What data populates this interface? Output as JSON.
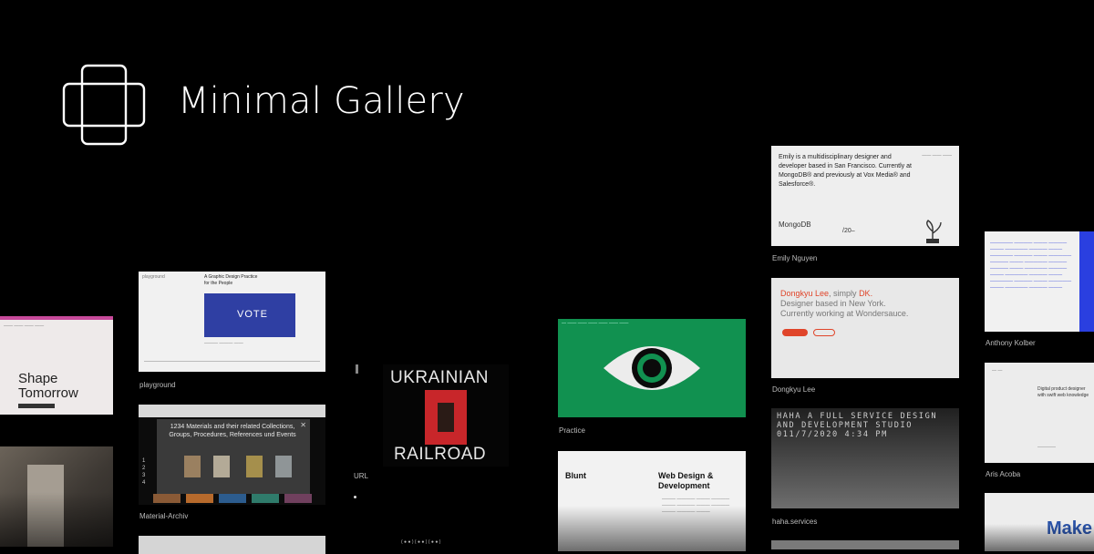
{
  "brand": {
    "name": "Minimal Gallery",
    "logo_icon": "overlapping-rectangles-icon"
  },
  "cards": {
    "shape": {
      "line1": "Shape",
      "line2": "Tomorrow"
    },
    "playground": {
      "caption": "playground",
      "title": "A Graphic Design Practice\nfor the People",
      "vote": "VOTE"
    },
    "material": {
      "caption": "Material-Archiv",
      "text": "1234 Materials and their related Collections, Groups, Procedures, References und Events",
      "nums": "1\n2\n3\n4"
    },
    "ukrainian": {
      "top": "UKRAINIAN",
      "bottom": "RAILROAD",
      "url": "URL"
    },
    "practice": {
      "caption": "Practice"
    },
    "blunt": {
      "left": "Blunt",
      "right": "Web Design &\nDevelopment"
    },
    "emily": {
      "caption": "Emily Nguyen",
      "text": "Emily is a multidisciplinary designer and developer based in San Francisco. Currently at MongoDB® and previously at Vox Media® and Salesforce®.",
      "logo": "MongoDB",
      "year": "/20–"
    },
    "dongkyu": {
      "caption": "Dongkyu Lee",
      "name": "Dongkyu Lee",
      "simply": ", simply ",
      "dk": "DK.",
      "rest": "Designer based in New York.\nCurrently working at Wondersauce."
    },
    "haha": {
      "caption": "haha.services",
      "text": "HAHA A FULL SERVICE DESIGN AND DEVELOPMENT STUDIO 011/7/2020 4:34 PM"
    },
    "anthony": {
      "caption": "Anthony Kolber"
    },
    "aris": {
      "caption": "Aris Acoba",
      "heading": "Digital product designer with swift web knowledge",
      "tagline": "Make"
    }
  },
  "colors": {
    "bg": "#000000",
    "green": "#119150",
    "red_accent": "#e0452a",
    "vote_blue": "#2f3fa3"
  }
}
